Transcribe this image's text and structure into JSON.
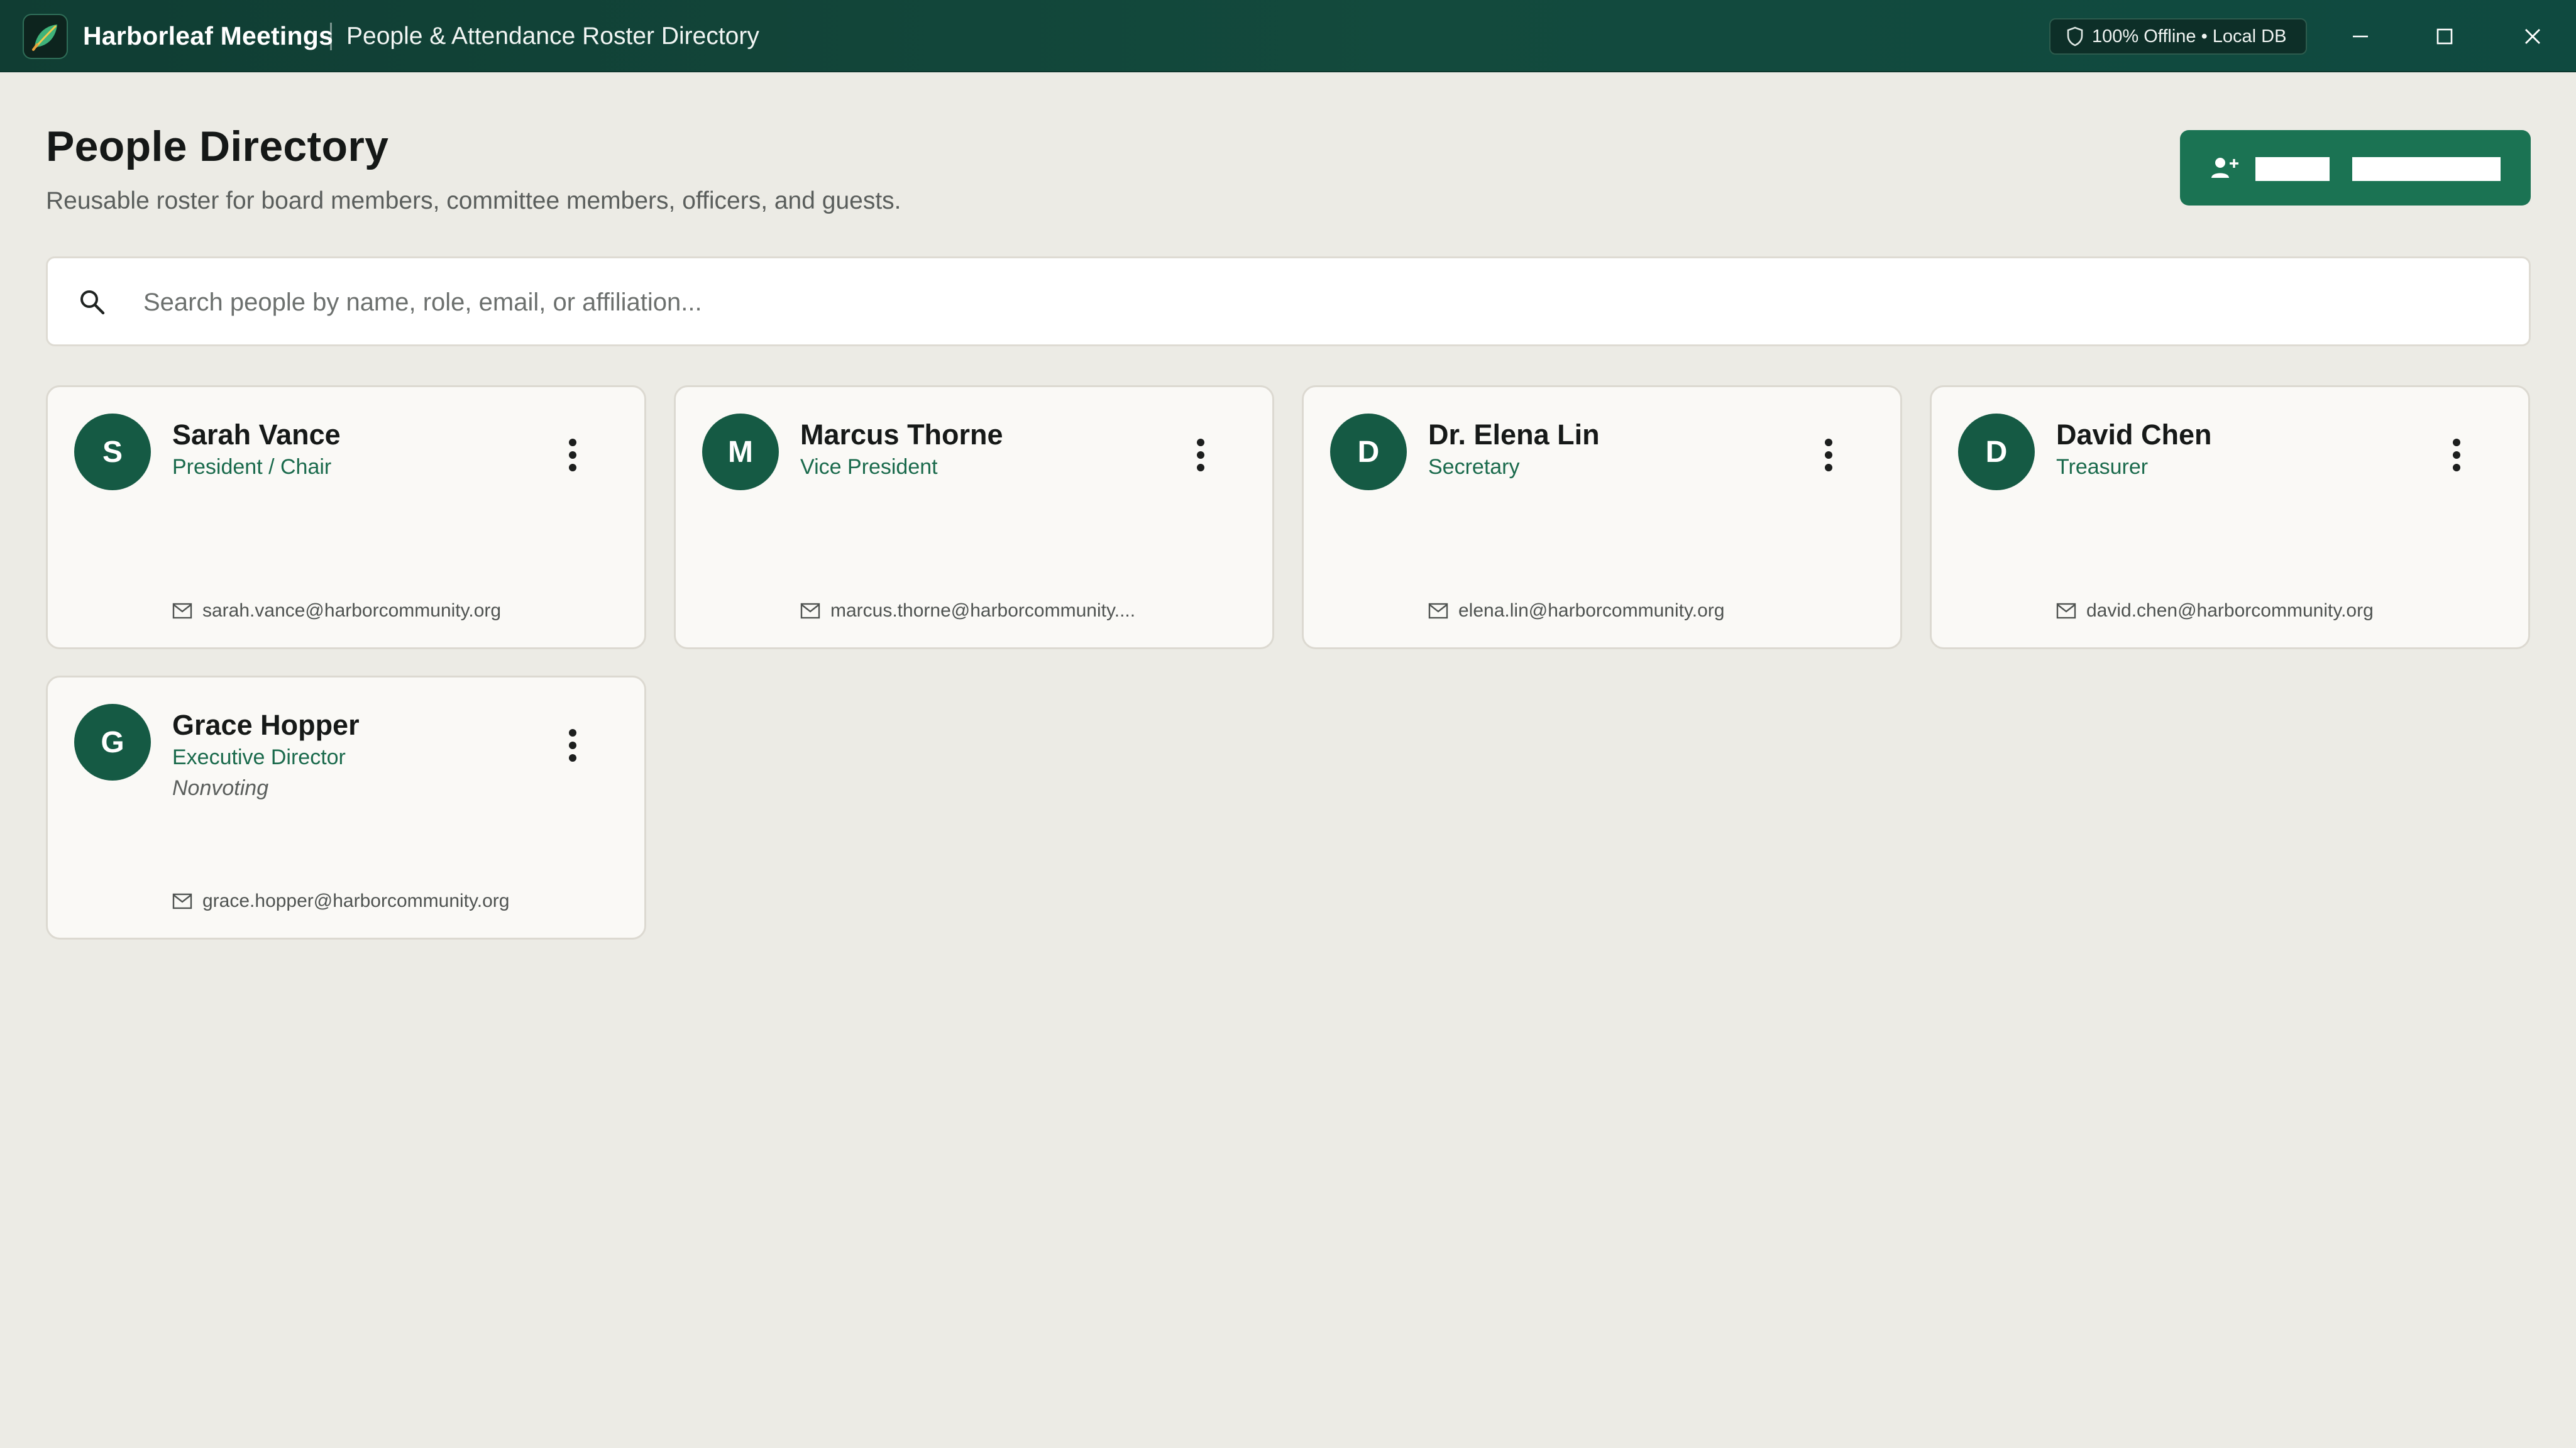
{
  "window": {
    "app_name": "Harborleaf Meetings",
    "title": "People & Attendance Roster Directory",
    "status_badge": "100% Offline • Local DB",
    "controls": [
      "minimize",
      "maximize",
      "close"
    ]
  },
  "header": {
    "title": "People Directory",
    "subtitle": "Reusable roster for board members, committee members, officers, and guests.",
    "add_button_icon": "person-add-icon"
  },
  "search": {
    "placeholder": "Search people by name, role, email, or affiliation...",
    "value": ""
  },
  "people": [
    {
      "initial": "S",
      "name": "Sarah Vance",
      "role": "President / Chair",
      "note": "",
      "email": "sarah.vance@harborcommunity.org"
    },
    {
      "initial": "M",
      "name": "Marcus Thorne",
      "role": "Vice President",
      "note": "",
      "email": "marcus.thorne@harborcommunity...."
    },
    {
      "initial": "D",
      "name": "Dr. Elena Lin",
      "role": "Secretary",
      "note": "",
      "email": "elena.lin@harborcommunity.org"
    },
    {
      "initial": "D",
      "name": "David Chen",
      "role": "Treasurer",
      "note": "",
      "email": "david.chen@harborcommunity.org"
    },
    {
      "initial": "G",
      "name": "Grace Hopper",
      "role": "Executive Director",
      "note": "Nonvoting",
      "email": "grace.hopper@harborcommunity.org"
    }
  ],
  "colors": {
    "titlebar": "#134a3d",
    "accent": "#1b7353",
    "avatar": "#155a44",
    "role_text": "#1a6a4c",
    "background": "#ecebe5"
  }
}
